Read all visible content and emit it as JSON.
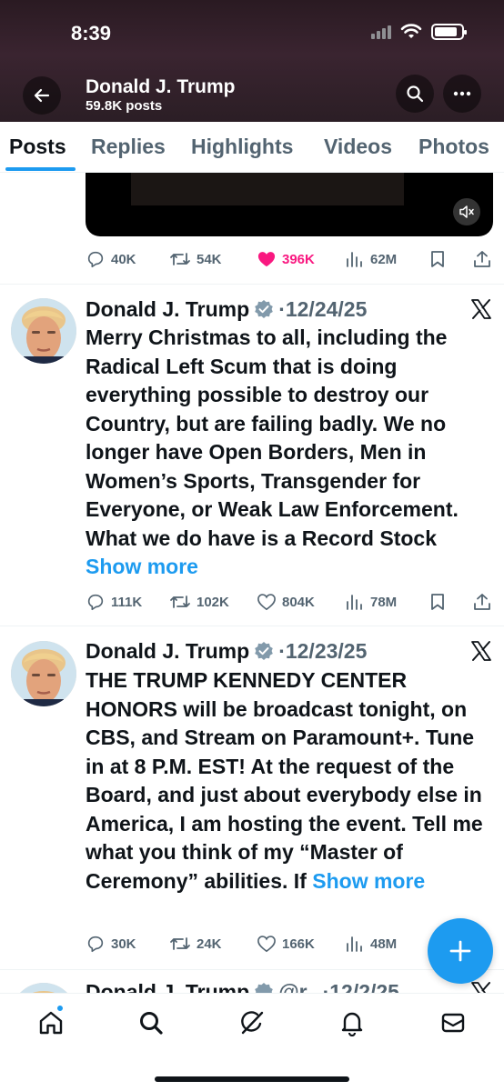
{
  "status_bar": {
    "time": "8:39"
  },
  "profile": {
    "name": "Donald J. Trump",
    "posts_count": "59.8K posts"
  },
  "tabs": [
    {
      "label": "Posts",
      "active": true
    },
    {
      "label": "Replies"
    },
    {
      "label": "Highlights"
    },
    {
      "label": "Videos"
    },
    {
      "label": "Photos"
    }
  ],
  "previous_post": {
    "replies": "40K",
    "reposts": "54K",
    "likes": "396K",
    "views": "62M",
    "liked": true
  },
  "posts": [
    {
      "author": "Donald J. Trump",
      "date": "·12/24/25",
      "text": "Merry Christmas to all, including the Radical Left Scum that is doing everything possible to destroy our Country, but are failing badly. We no longer have Open Borders, Men in Women’s Sports, Transgender for Everyone, or Weak Law Enforcement. What we do have is a Record Stock",
      "show_more": "Show more",
      "replies": "111K",
      "reposts": "102K",
      "likes": "804K",
      "views": "78M"
    },
    {
      "author": "Donald J. Trump",
      "date": "·12/23/25",
      "text": "THE TRUMP KENNEDY CENTER HONORS will be broadcast tonight, on CBS, and Stream on Paramount+. Tune in at 8 P.M. EST! At the request of the Board, and just about everybody else in America, I am hosting the event. Tell me what you think of my “Master of Ceremony” abilities. If",
      "show_more": "Show more",
      "replies": "30K",
      "reposts": "24K",
      "likes": "166K",
      "views": "48M"
    },
    {
      "author": "Donald J. Trump",
      "handle": "@r",
      "date": "·12/2/25"
    }
  ],
  "colors": {
    "accent": "#1d9bf0",
    "like": "#f91880",
    "secondary_text": "#536471"
  },
  "icons": {
    "header": [
      "back-arrow-icon",
      "search-icon",
      "more-icon"
    ],
    "actions": [
      "reply-icon",
      "repost-icon",
      "like-icon",
      "views-icon",
      "bookmark-icon",
      "share-icon"
    ],
    "nav": [
      "home-icon",
      "search-icon",
      "grok-icon",
      "notifications-icon",
      "messages-icon"
    ],
    "fab": "plus-icon"
  }
}
